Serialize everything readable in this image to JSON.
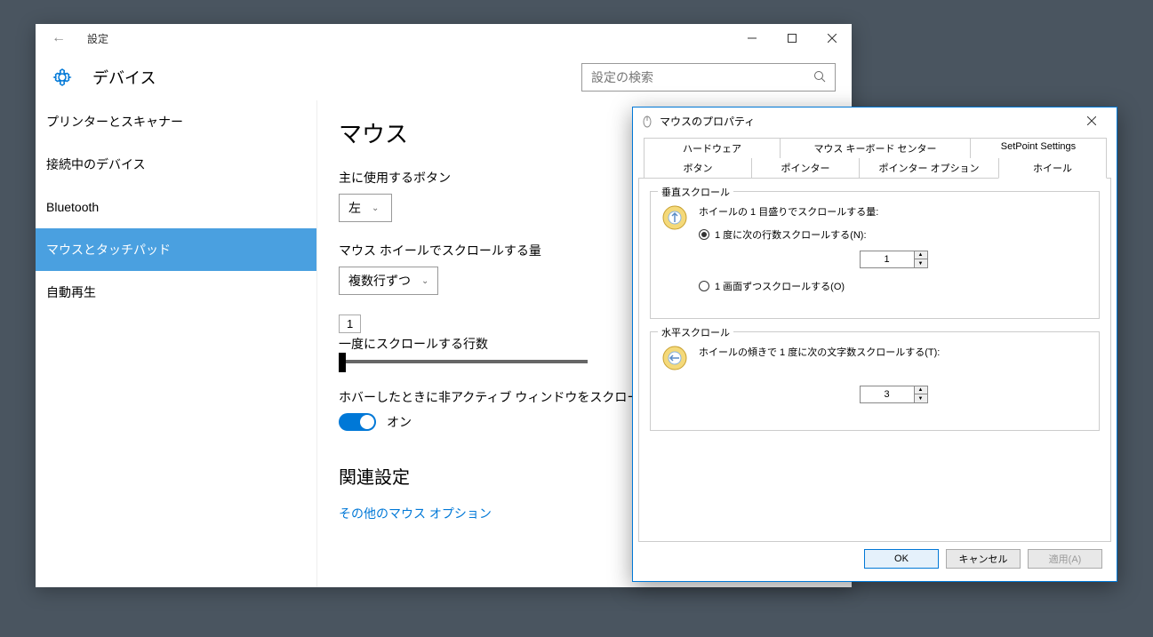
{
  "settings": {
    "title": "設定",
    "header": "デバイス",
    "search_placeholder": "設定の検索",
    "sidebar": [
      {
        "label": "プリンターとスキャナー"
      },
      {
        "label": "接続中のデバイス"
      },
      {
        "label": "Bluetooth"
      },
      {
        "label": "マウスとタッチパッド"
      },
      {
        "label": "自動再生"
      }
    ],
    "content": {
      "h1": "マウス",
      "primary_button_label": "主に使用するボタン",
      "primary_button_value": "左",
      "wheel_label": "マウス ホイールでスクロールする量",
      "wheel_value": "複数行ずつ",
      "tooltip": "1",
      "lines_label": "一度にスクロールする行数",
      "hover_label": "ホバーしたときに非アクティブ ウィンドウをスクロールする",
      "toggle_text": "オン",
      "related_h": "関連設定",
      "link": "その他のマウス オプション"
    }
  },
  "dialog": {
    "title": "マウスのプロパティ",
    "tabs_row1": [
      "ハードウェア",
      "マウス キーボード センター",
      "SetPoint Settings"
    ],
    "tabs_row2": [
      "ボタン",
      "ポインター",
      "ポインター オプション",
      "ホイール"
    ],
    "group1": {
      "title": "垂直スクロール",
      "line1": "ホイールの 1 目盛りでスクロールする量:",
      "radio1": "1 度に次の行数スクロールする(N):",
      "spinner1": "1",
      "radio2": "1 画面ずつスクロールする(O)"
    },
    "group2": {
      "title": "水平スクロール",
      "line1": "ホイールの傾きで 1 度に次の文字数スクロールする(T):",
      "spinner1": "3"
    },
    "buttons": {
      "ok": "OK",
      "cancel": "キャンセル",
      "apply": "適用(A)"
    }
  }
}
